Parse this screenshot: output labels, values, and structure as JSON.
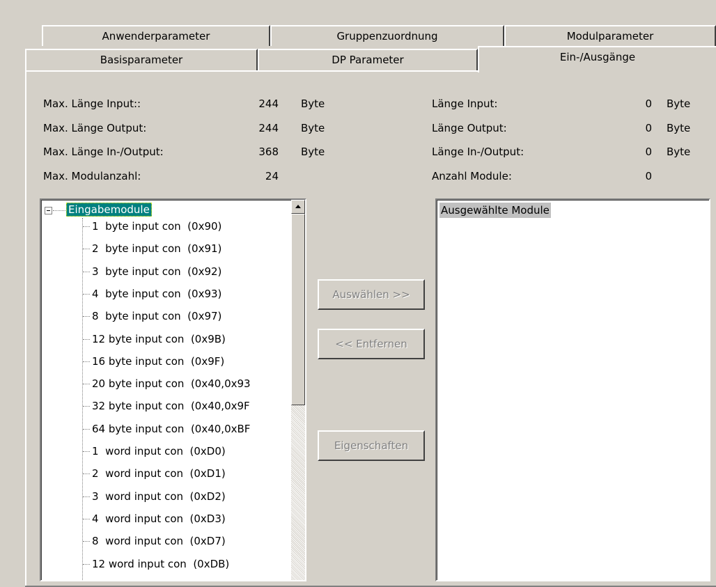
{
  "tabs": {
    "row1": [
      "Anwenderparameter",
      "Gruppenzuordnung",
      "Modulparameter"
    ],
    "row2": [
      "Basisparameter",
      "DP Parameter",
      "Ein-/Ausgänge"
    ],
    "active": "Ein-/Ausgänge"
  },
  "limits": {
    "max_input_label": "Max. Länge Input::",
    "max_input_value": "244",
    "max_output_label": "Max. Länge Output:",
    "max_output_value": "244",
    "max_inout_label": "Max. Länge In-/Output:",
    "max_inout_value": "368",
    "max_modules_label": "Max. Modulanzahl:",
    "max_modules_value": "24",
    "unit": "Byte"
  },
  "current": {
    "input_label": "Länge Input:",
    "input_value": "0",
    "output_label": "Länge Output:",
    "output_value": "0",
    "inout_label": "Länge In-/Output:",
    "inout_value": "0",
    "modules_label": "Anzahl Module:",
    "modules_value": "0",
    "unit": "Byte"
  },
  "tree": {
    "root": "Eingabemodule",
    "items": [
      "1  byte input con  (0x90)",
      "2  byte input con  (0x91)",
      "3  byte input con  (0x92)",
      "4  byte input con  (0x93)",
      "8  byte input con  (0x97)",
      "12 byte input con  (0x9B)",
      "16 byte input con  (0x9F)",
      "20 byte input con  (0x40,0x93",
      "32 byte input con  (0x40,0x9F",
      "64 byte input con  (0x40,0xBF",
      "1  word input con  (0xD0)",
      "2  word input con  (0xD1)",
      "3  word input con  (0xD2)",
      "4  word input con  (0xD3)",
      "8  word input con  (0xD7)",
      "12 word input con  (0xDB)"
    ]
  },
  "buttons": {
    "select": "Auswählen >>",
    "remove": "<< Entfernen",
    "properties": "Eigenschaften"
  },
  "selected_list": {
    "header": "Ausgewählte Module"
  }
}
